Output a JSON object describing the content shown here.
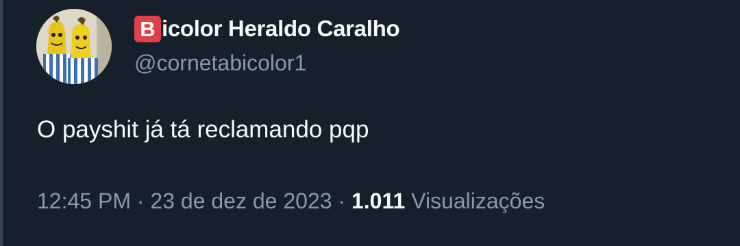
{
  "author": {
    "emoji_letter": "B",
    "display_name": "icolor Heraldo Caralho",
    "handle": "@cornetabicolor1"
  },
  "tweet": {
    "text": "O payshit já tá reclamando pqp"
  },
  "meta": {
    "time": "12:45 PM",
    "separator": "·",
    "date": "23 de dez de 2023",
    "views_count": "1.011",
    "views_label": "Visualizações"
  },
  "colors": {
    "background": "#15202b",
    "primary_text": "#f7f9f9",
    "secondary_text": "#8b98a5",
    "emoji_badge": "#e0404a"
  }
}
